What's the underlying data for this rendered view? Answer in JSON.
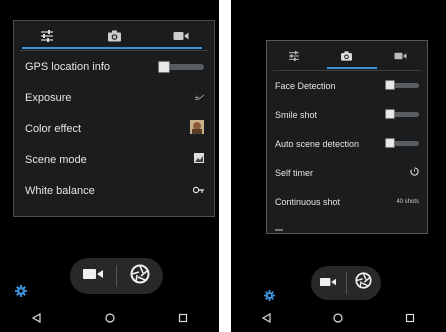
{
  "left_screen": {
    "tabs": [
      {
        "icon": "sliders-icon",
        "active": true
      },
      {
        "icon": "camera-icon",
        "active": false
      },
      {
        "icon": "video-camera-icon",
        "active": false
      }
    ],
    "settings": [
      {
        "label": "GPS location info",
        "control": "toggle",
        "state": "off"
      },
      {
        "label": "Exposure",
        "control": "exposure-icon"
      },
      {
        "label": "Color effect",
        "control": "color-effect-thumbnail-icon"
      },
      {
        "label": "Scene mode",
        "control": "scene-mode-icon"
      },
      {
        "label": "White balance",
        "control": "white-balance-icon"
      }
    ]
  },
  "right_screen": {
    "tabs": [
      {
        "icon": "sliders-icon",
        "active": false
      },
      {
        "icon": "camera-icon",
        "active": true
      },
      {
        "icon": "video-camera-icon",
        "active": false
      }
    ],
    "settings": [
      {
        "label": "Face Detection",
        "control": "toggle",
        "state": "off"
      },
      {
        "label": "Smile shot",
        "control": "toggle",
        "state": "off"
      },
      {
        "label": "Auto scene detection",
        "control": "toggle",
        "state": "off"
      },
      {
        "label": "Self timer",
        "control": "timer-icon"
      },
      {
        "label": "Continuous shot",
        "value": "40 shots"
      }
    ]
  },
  "colors": {
    "screen_bg": "#000000",
    "panel_bg": "#1a1c1e",
    "accent": "#3d8fd6",
    "text": "#e6e6e6"
  }
}
